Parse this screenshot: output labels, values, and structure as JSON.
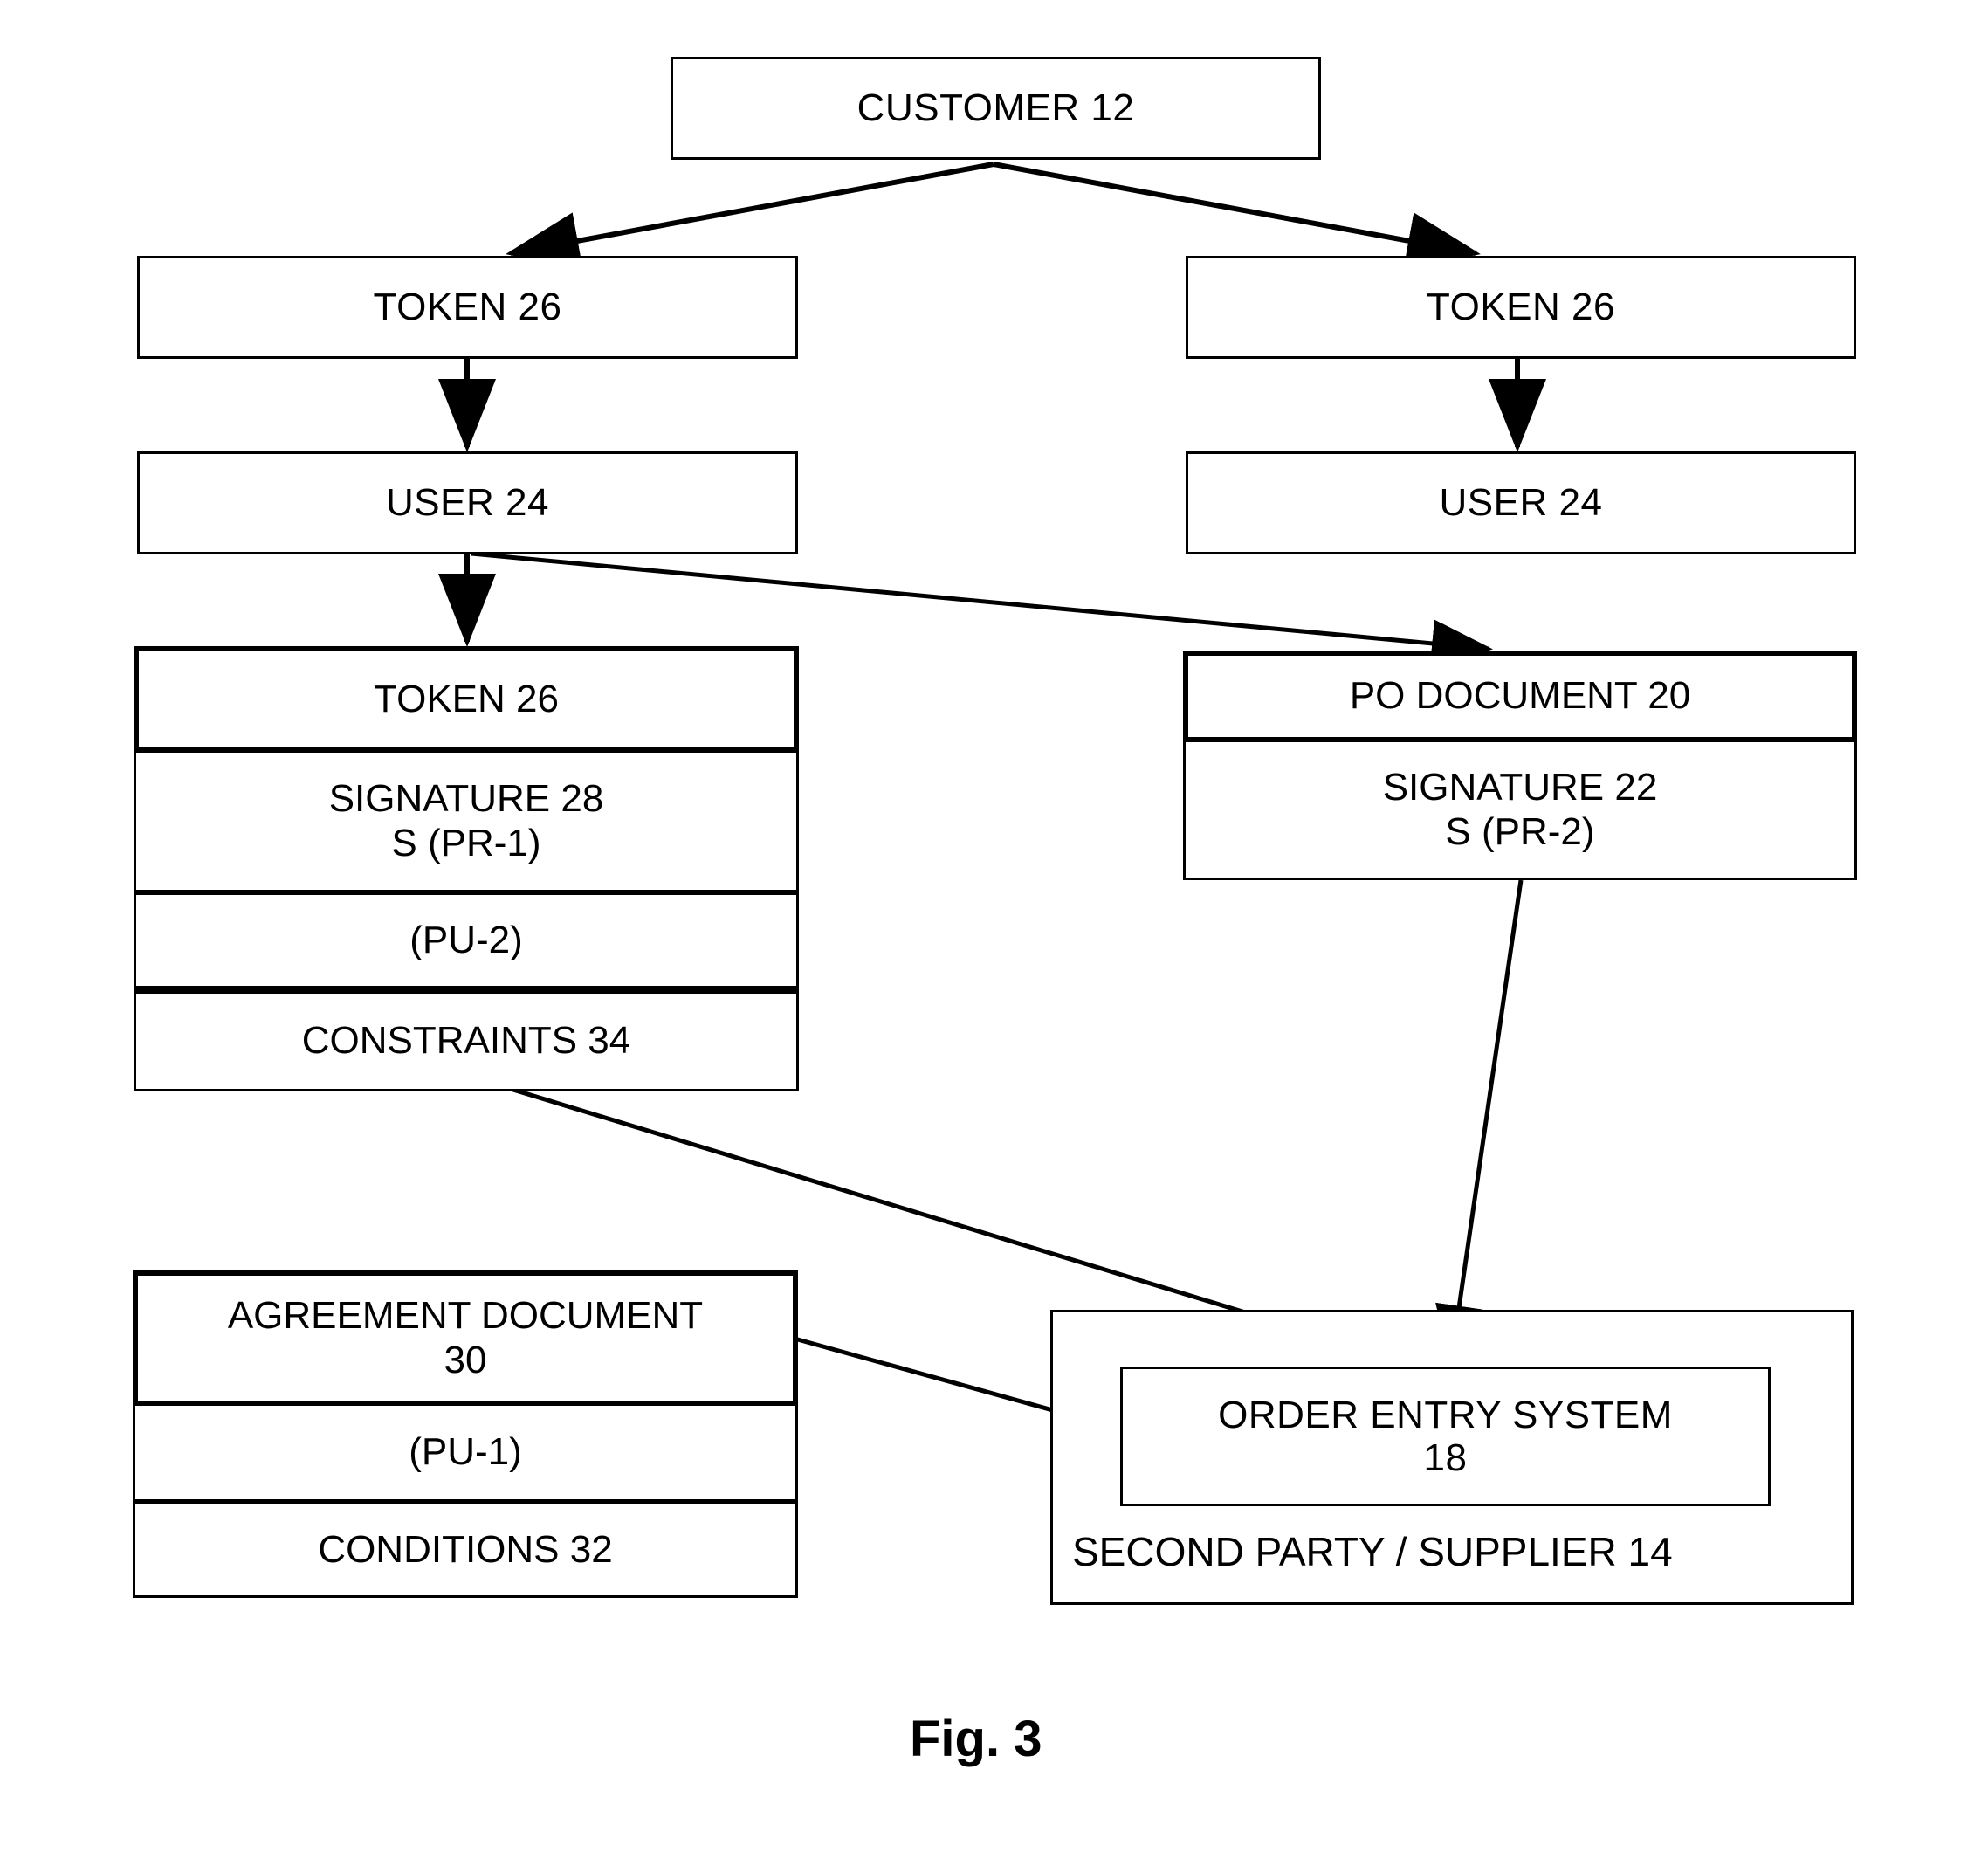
{
  "figure": {
    "caption": "Fig. 3"
  },
  "nodes": {
    "customer": {
      "label": "CUSTOMER 12"
    },
    "token_left_top": {
      "label": "TOKEN 26"
    },
    "token_right_top": {
      "label": "TOKEN 26"
    },
    "user_left": {
      "label": "USER 24"
    },
    "user_right": {
      "label": "USER 24"
    },
    "token_composite": {
      "header": "TOKEN 26",
      "rows": [
        {
          "label": "SIGNATURE 28\nS (PR-1)"
        },
        {
          "label": "(PU-2)"
        },
        {
          "label": "CONSTRAINTS 34"
        }
      ]
    },
    "po_document": {
      "header": "PO DOCUMENT 20",
      "rows": [
        {
          "label": "SIGNATURE 22\nS (PR-2)"
        }
      ]
    },
    "agreement_document": {
      "header": "AGREEMENT DOCUMENT\n30",
      "rows": [
        {
          "label": "(PU-1)"
        },
        {
          "label": "CONDITIONS 32"
        }
      ]
    },
    "order_entry_system": {
      "label": "ORDER ENTRY SYSTEM\n18"
    },
    "second_party": {
      "label": "SECOND PARTY / SUPPLIER 14"
    }
  },
  "colors": {
    "line": "#000000",
    "fill": "#ffffff"
  }
}
